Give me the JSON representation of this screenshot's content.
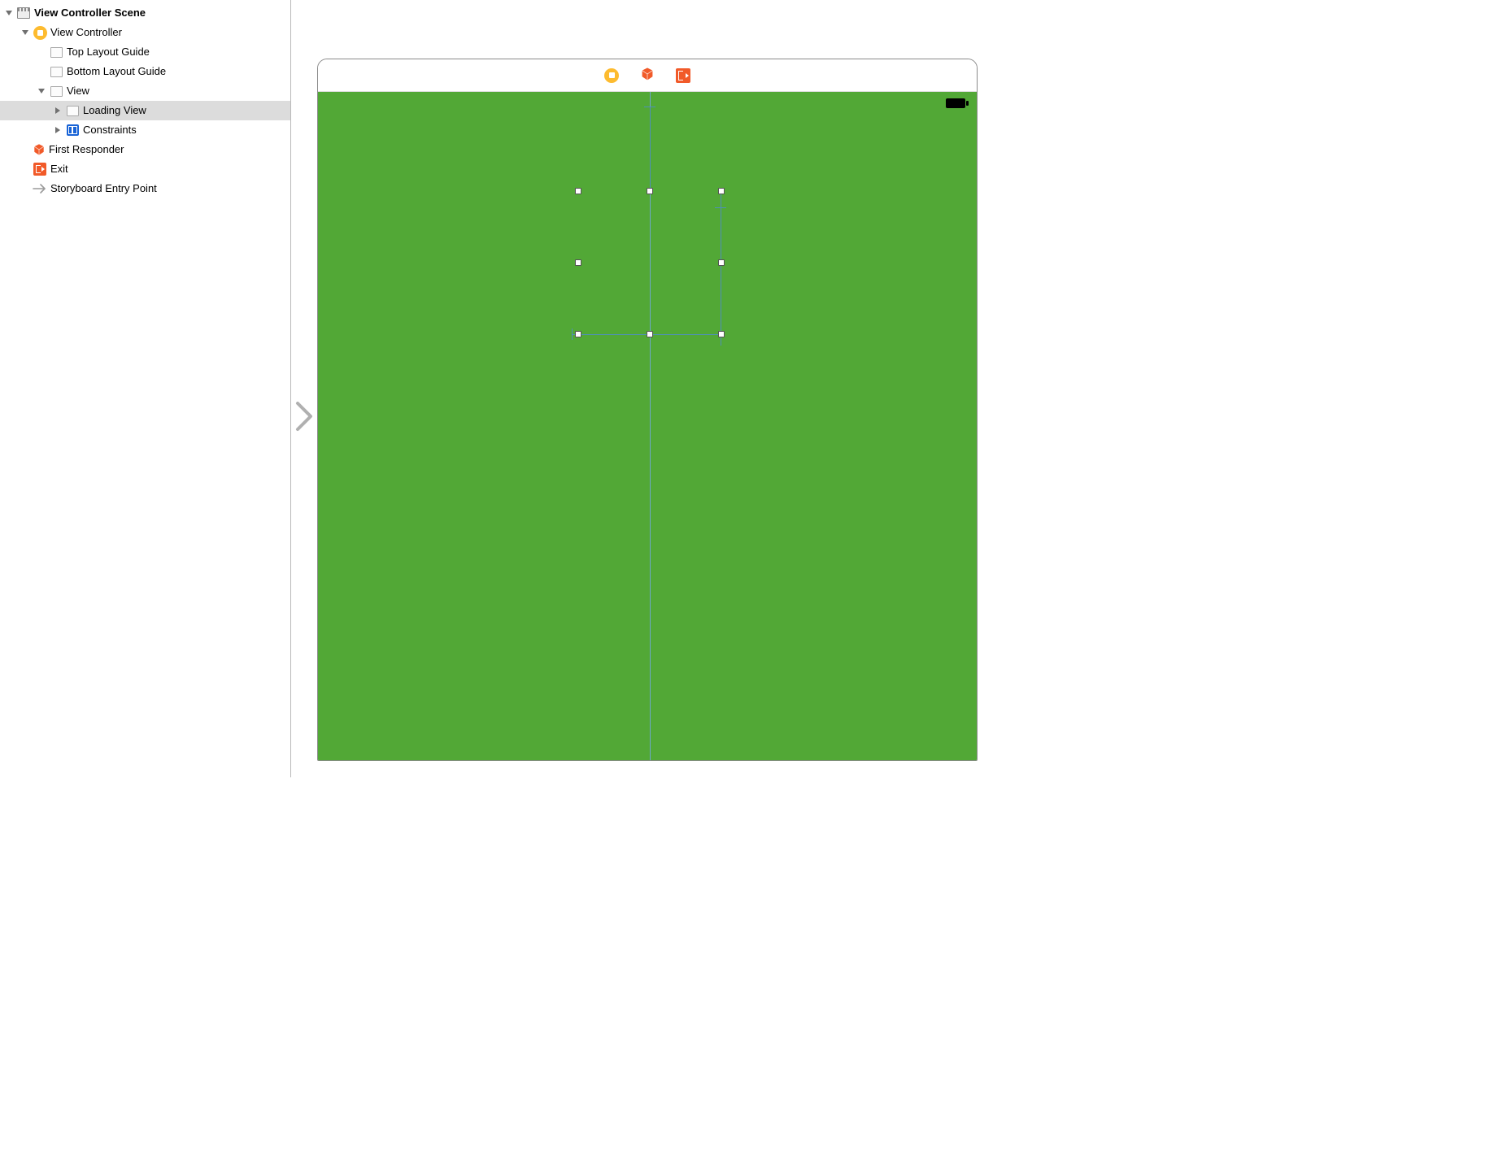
{
  "outline": {
    "scene": "View Controller Scene",
    "vc": "View Controller",
    "top_guide": "Top Layout Guide",
    "bottom_guide": "Bottom Layout Guide",
    "view": "View",
    "loading_view": "Loading View",
    "constraints": "Constraints",
    "first_responder": "First Responder",
    "exit": "Exit",
    "entry_point": "Storyboard Entry Point"
  },
  "canvas": {
    "background_color": "#52A836",
    "guide_color": "#4f90b8",
    "selected_view": "Loading View"
  }
}
